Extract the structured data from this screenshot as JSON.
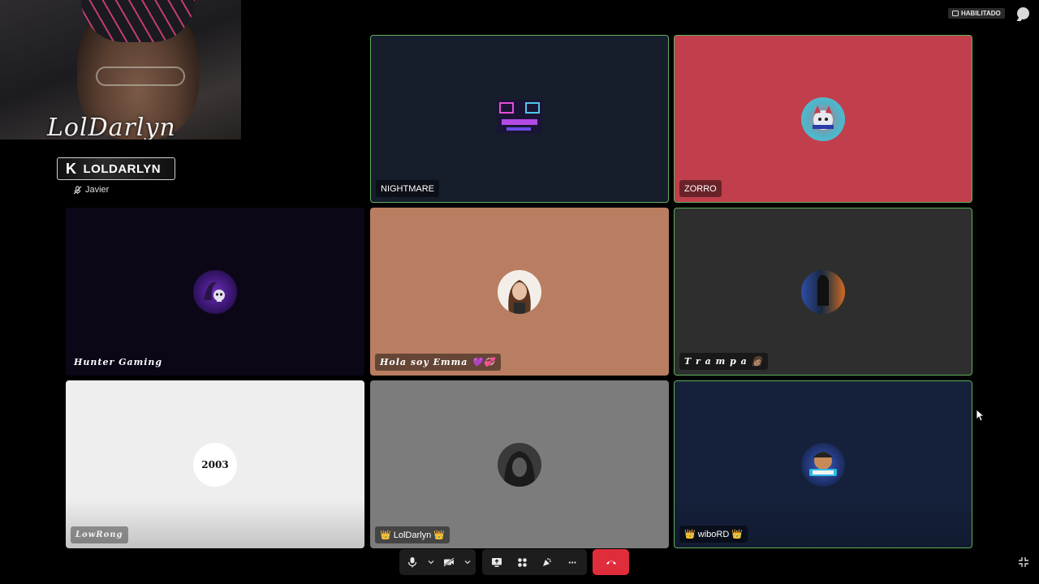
{
  "stream_overlay": {
    "logo_text": "LolDarlyn",
    "badge_text": "LOLDARLYN",
    "badge_icon": "kick-k-icon",
    "caption": "Javier",
    "caption_icon": "muted-mic-icon"
  },
  "status": {
    "chip_label": "HABILITADO",
    "chip_icon": "caption-icon",
    "chat_icon": "chat-bubble-icon"
  },
  "participants": [
    {
      "name": "NIGHTMARE",
      "tile_color": "#161d2b",
      "speaking": true
    },
    {
      "name": "ZORRO",
      "tile_color": "#c13f4c",
      "speaking": true
    },
    {
      "name": "Hunter Gaming",
      "tile_color": "#0b0717",
      "speaking": false
    },
    {
      "name": "Hola soy Emma 💜💞",
      "tile_color": "#b97e61",
      "speaking": false
    },
    {
      "name": "T r a m p a 👩🏽",
      "tile_color": "#2e2e2e",
      "speaking": true
    },
    {
      "name": "LowRong",
      "avatar_text": "2003",
      "tile_color": "#eeeeee",
      "speaking": false
    },
    {
      "name": "👑 LolDarlyn 👑",
      "tile_color": "#7c7c7c",
      "speaking": false
    },
    {
      "name": "👑 wiboRD 👑",
      "tile_color": "#15203a",
      "speaking": true
    }
  ],
  "toolbar": {
    "mic_icon": "microphone-icon",
    "camera_off_icon": "camera-off-icon",
    "share_icon": "screen-share-icon",
    "apps_icon": "apps-grid-icon",
    "reactions_icon": "reactions-icon",
    "more_icon": "more-dots-icon",
    "more_label": "···",
    "hangup_icon": "hang-up-icon"
  }
}
